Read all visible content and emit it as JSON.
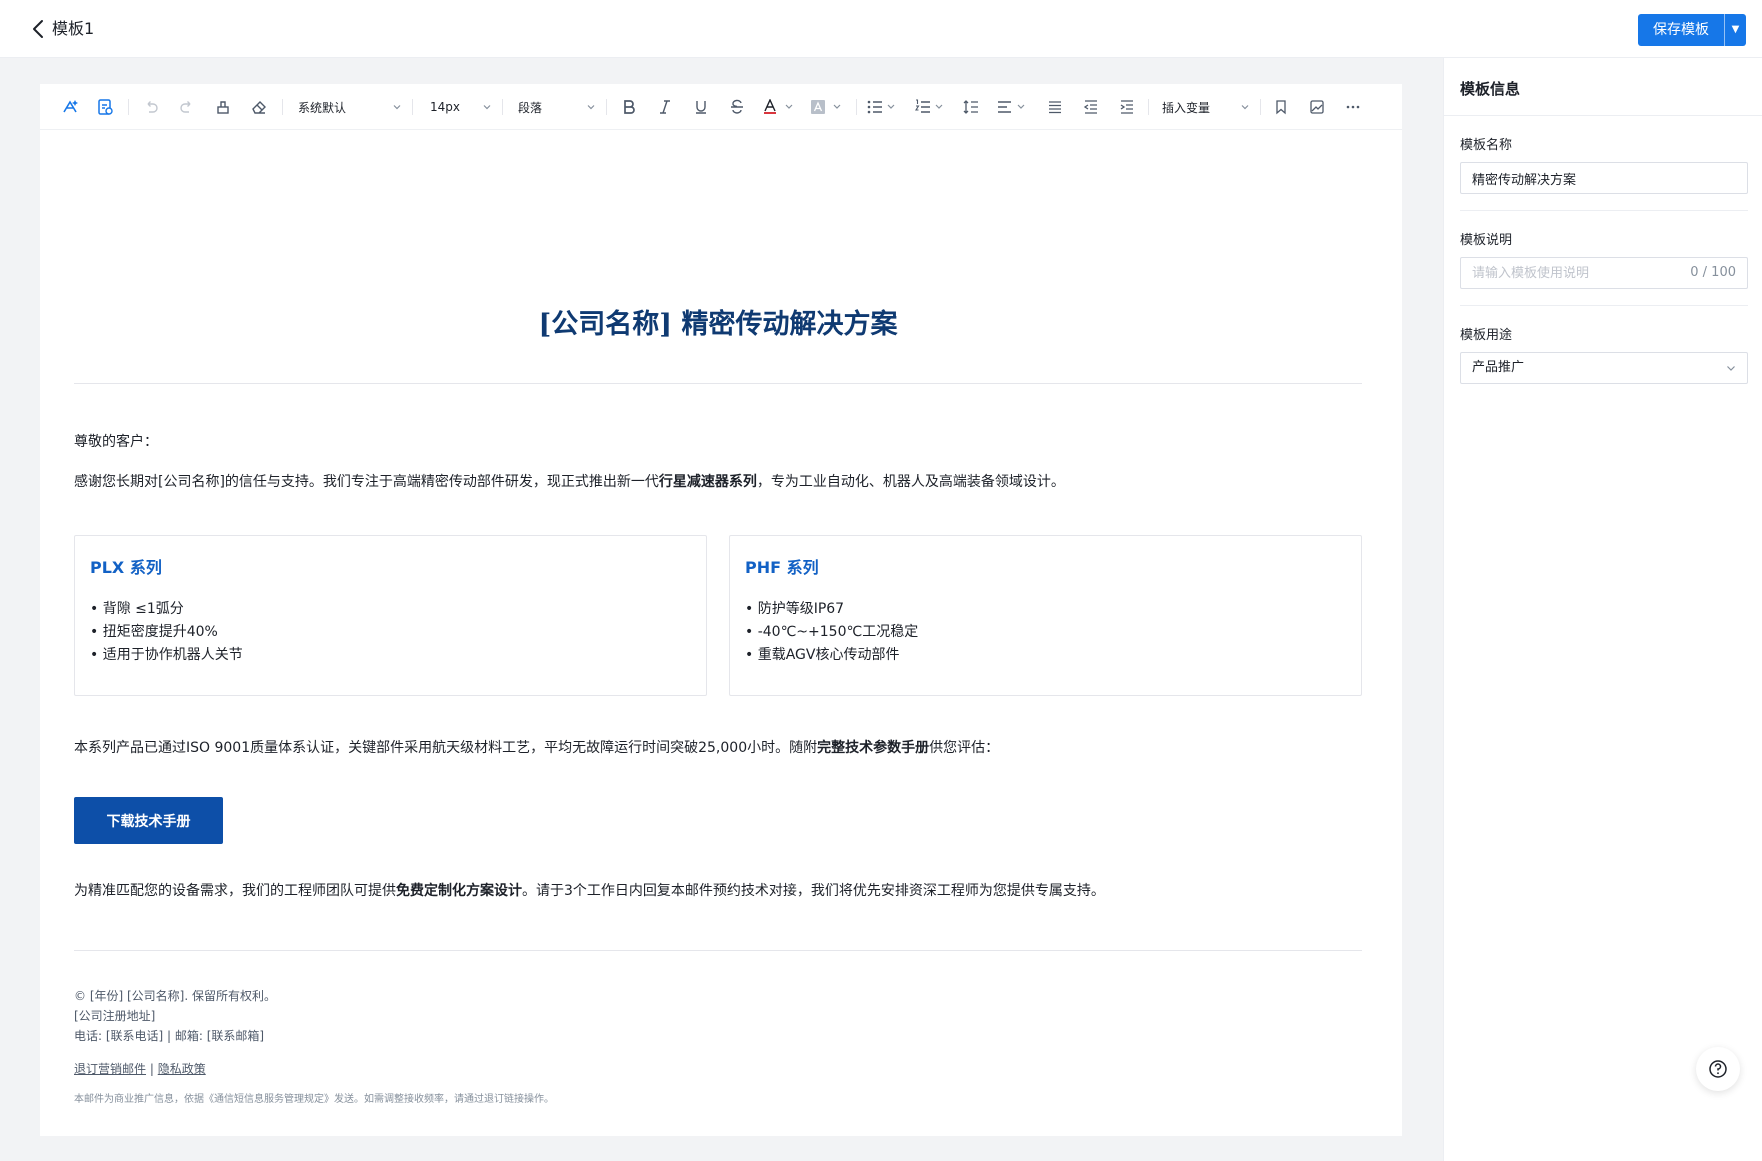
{
  "header": {
    "template_title": "模板1",
    "save_label": "保存模板"
  },
  "toolbar": {
    "font_family": "系统默认",
    "font_size": "14px",
    "block_type": "段落",
    "insert_variable": "插入变量",
    "text_color": "#d9363e"
  },
  "document": {
    "title": "[公司名称] 精密传动解决方案",
    "greeting": "尊敬的客户：",
    "intro": {
      "before": "感谢您长期对[公司名称]的信任与支持。我们专注于高端精密传动部件研发，现正式推出新一代",
      "bold": "行星减速器系列",
      "after": "，专为工业自动化、机器人及高端装备领域设计。"
    },
    "cards": [
      {
        "title": "PLX 系列",
        "items": [
          "• 背隙 ≤1弧分",
          "• 扭矩密度提升40%",
          "• 适用于协作机器人关节"
        ]
      },
      {
        "title": "PHF 系列",
        "items": [
          "• 防护等级IP67",
          "• -40℃~+150℃工况稳定",
          "• 重载AGV核心传动部件"
        ]
      }
    ],
    "cert": {
      "before": "本系列产品已通过ISO 9001质量体系认证，关键部件采用航天级材料工艺，平均无故障运行时间突破25,000小时。随附",
      "bold": "完整技术参数手册",
      "after": "供您评估："
    },
    "download_label": "下载技术手册",
    "service": {
      "before": "为精准匹配您的设备需求，我们的工程师团队可提供",
      "bold": "免费定制化方案设计",
      "after": "。请于3个工作日内回复本邮件预约技术对接，我们将优先安排资深工程师为您提供专属支持。"
    },
    "footer": {
      "copyright": "© [年份] [公司名称]. 保留所有权利。",
      "address": "[公司注册地址]",
      "contact": "电话: [联系电话] | 邮箱: [联系邮箱]",
      "unsubscribe": "退订营销邮件",
      "divider": "|",
      "privacy": "隐私政策",
      "note": "本邮件为商业推广信息，依据《通信短信息服务管理规定》发送。如需调整接收频率，请通过退订链接操作。"
    },
    "title_color": "#0f3a72",
    "card_title_color": "#1261c5",
    "button_color": "#0d4fa8"
  },
  "panel": {
    "title": "模板信息",
    "name_label": "模板名称",
    "name_value": "精密传动解决方案",
    "desc_label": "模板说明",
    "desc_placeholder": "请输入模板使用说明",
    "desc_count": "0 / 100",
    "usage_label": "模板用途",
    "usage_value": "产品推广"
  },
  "colors": {
    "accent": "#1677e8"
  }
}
